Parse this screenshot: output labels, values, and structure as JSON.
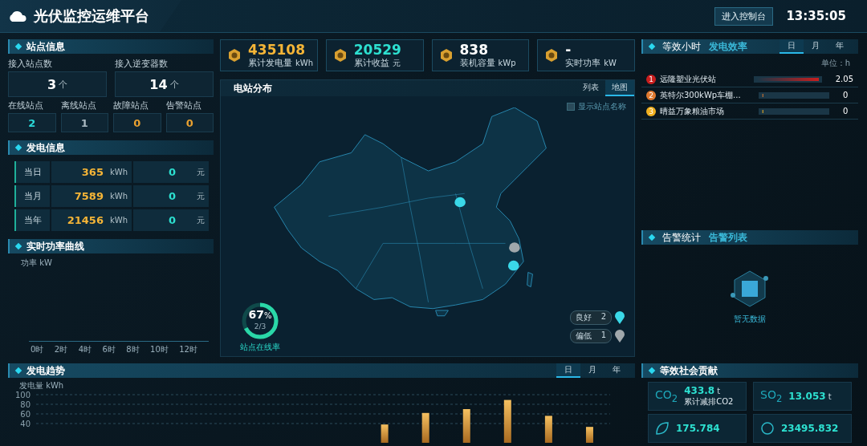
{
  "header": {
    "title": "光伏监控运维平台",
    "console_button": "进入控制台",
    "time": "13:35:05"
  },
  "station_info": {
    "title": "站点信息",
    "totals": [
      {
        "label": "接入站点数",
        "value": "3",
        "unit": "个"
      },
      {
        "label": "接入逆变器数",
        "value": "14",
        "unit": "个"
      }
    ],
    "statuses": [
      {
        "label": "在线站点",
        "value": "2",
        "color": "#2ad8d8"
      },
      {
        "label": "离线站点",
        "value": "1",
        "color": "#a9b9c2"
      },
      {
        "label": "故障站点",
        "value": "0",
        "color": "#e8a030"
      },
      {
        "label": "告警站点",
        "value": "0",
        "color": "#e8a030"
      }
    ]
  },
  "generation_info": {
    "title": "发电信息",
    "rows": [
      {
        "period": "当日",
        "energy": "365",
        "energy_unit": "kWh",
        "income": "0",
        "income_unit": "元"
      },
      {
        "period": "当月",
        "energy": "7589",
        "energy_unit": "kWh",
        "income": "0",
        "income_unit": "元"
      },
      {
        "period": "当年",
        "energy": "21456",
        "energy_unit": "kWh",
        "income": "0",
        "income_unit": "元"
      }
    ]
  },
  "power_curve": {
    "title": "实时功率曲线",
    "ylabel": "功率 kW",
    "xticks": [
      "0时",
      "2时",
      "4时",
      "6时",
      "8时",
      "10时",
      "12时"
    ]
  },
  "kpis": [
    {
      "value": "435108",
      "label": "累计发电量",
      "unit": "kWh",
      "color": "#f5b537"
    },
    {
      "value": "20529",
      "label": "累计收益",
      "unit": "元",
      "color": "#2de0d0"
    },
    {
      "value": "838",
      "label": "装机容量",
      "unit": "kWp",
      "color": "#ffffff"
    },
    {
      "value": "-",
      "label": "实时功率",
      "unit": "kW",
      "color": "#ffffff"
    }
  ],
  "map": {
    "title": "电站分布",
    "tabs": [
      {
        "label": "列表",
        "selected": false
      },
      {
        "label": "地图",
        "selected": true
      }
    ],
    "show_names": {
      "label": "显示站点名称",
      "checked": false
    },
    "online_rate": {
      "percent": "67",
      "unit": "%",
      "fraction": "2/3",
      "label": "站点在线率",
      "level": 0.67
    },
    "legend": [
      {
        "label": "良好",
        "count": "2",
        "color": "#3ad8e8"
      },
      {
        "label": "偏低",
        "count": "1",
        "color": "#a0a8ac"
      }
    ]
  },
  "efficiency": {
    "tabs": [
      {
        "label": "等效小时",
        "selected": true
      },
      {
        "label": "发电效率",
        "selected": false
      }
    ],
    "period_tabs": [
      {
        "label": "日",
        "selected": true
      },
      {
        "label": "月",
        "selected": false
      },
      {
        "label": "年",
        "selected": false
      }
    ],
    "unit": "单位：h",
    "rows": [
      {
        "rank": "1",
        "name": "远隆塑业光伏站",
        "level": 1.0,
        "value": "2.05",
        "color": "#c81e1e"
      },
      {
        "rank": "2",
        "name": "英特尔300kWp车棚...",
        "level": 0.02,
        "value": "0",
        "color": "#e07a30"
      },
      {
        "rank": "3",
        "name": "晴益万象粮油市场",
        "level": 0.02,
        "value": "0",
        "color": "#f0b020"
      }
    ]
  },
  "alarms": {
    "tabs": [
      {
        "label": "告警统计",
        "selected": true
      },
      {
        "label": "告警列表",
        "selected": false
      }
    ],
    "empty_text": "暂无数据"
  },
  "trend": {
    "title": "发电趋势",
    "period_tabs": [
      {
        "label": "日",
        "selected": true
      },
      {
        "label": "月",
        "selected": false
      },
      {
        "label": "年",
        "selected": false
      }
    ],
    "chart_data": {
      "type": "bar",
      "ylabel": "发电量 kWh",
      "ylim": [
        0,
        100
      ],
      "yticks": [
        40,
        60,
        80,
        100
      ],
      "grid": true,
      "values": [
        0,
        0,
        0,
        0,
        0,
        0,
        0,
        0,
        38,
        62,
        70,
        89,
        56,
        33
      ]
    }
  },
  "social": {
    "title": "等效社会贡献",
    "items": [
      {
        "kind": "co2",
        "symbol": "CO$_{2}$",
        "value": "433.8",
        "unit": "t",
        "label": "累计减排CO2"
      },
      {
        "kind": "so2",
        "symbol": "SO$_{2}$",
        "value": "13.053",
        "unit": "t"
      },
      {
        "kind": "tree",
        "value": "175.784"
      },
      {
        "kind": "coal",
        "value": "23495.832"
      }
    ]
  }
}
